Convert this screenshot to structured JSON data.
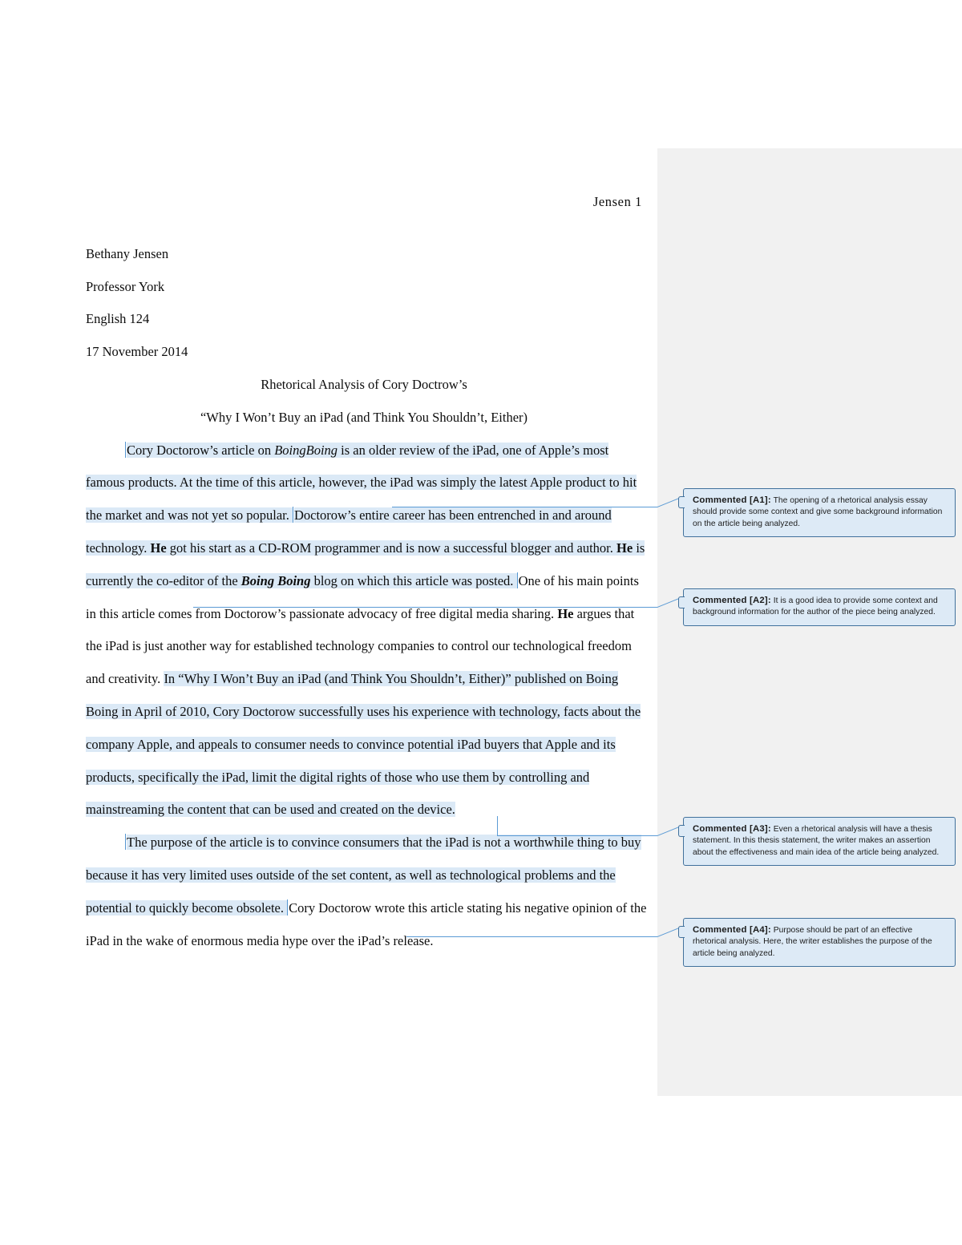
{
  "document": {
    "running_head": "Jensen  1",
    "heading": {
      "author": "Bethany Jensen",
      "instructor": "Professor York",
      "course": "English 124",
      "date": "17 November 2014"
    },
    "title_line_1": "Rhetorical Analysis of Cory Doctrow’s",
    "title_line_2": "“Why I Won’t Buy an iPad (and Think You Shouldn’t, Either)",
    "paragraph_1": {
      "seg_1": "Cory Doctorow’s article on ",
      "seg_2_italic": "BoingBoing",
      "seg_3": " is an older review of the iPad, one of Apple’s most famous products. At the time of this article, however, the iPad was simply the latest Apple product to hit the market and was not yet so popular. ",
      "seg_4": "Doctorow’s entire career has been entrenched in and around technology. ",
      "seg_5_bold": "He",
      "seg_6": " got his start as a CD-ROM programmer and is now a successful blogger and author. ",
      "seg_7_bold": "He",
      "seg_8": " is currently the co-editor of the ",
      "seg_9_italic": "Boing Boing",
      "seg_10": " blog on which this article was posted. ",
      "seg_11": "One of his main points in this article comes from Doctorow’s passionate advocacy of free digital media sharing. ",
      "seg_12_bold": "He",
      "seg_13": " argues that the iPad is just another way for established technology companies to control our technological freedom and creativity. ",
      "seg_14": "In “Why I Won’t Buy an iPad (and Think You Shouldn’t, Either)” published on Boing Boing in April of 2010, Cory Doctorow successfully uses his experience with technology, facts about the company Apple, and appeals to consumer needs to convince potential iPad buyers that Apple and its products, specifically the iPad, limit the digital rights of those who use them by controlling and mainstreaming the content that can be used and created on the device."
    },
    "paragraph_2": {
      "seg_1": "The purpose of the article is to convince consumers that the iPad is not a worthwhile thing to buy because it has very limited uses outside of the set content, as well as technological problems and the potential to quickly become obsolete. ",
      "seg_2": "Cory Doctorow wrote this article stating his negative opinion of the iPad in the wake of enormous media hype over the iPad’s release."
    }
  },
  "comments": [
    {
      "tag": "Commented [A1]:",
      "text": " The opening of a rhetorical analysis essay should provide some context and give some background information on the article being analyzed."
    },
    {
      "tag": "Commented [A2]:",
      "text": " It is a good idea to provide some context and background information for the author of the piece being analyzed."
    },
    {
      "tag": "Commented [A3]:",
      "text": " Even a rhetorical analysis will have a thesis statement. In this thesis statement, the writer makes an assertion about the effectiveness and main idea of the article being analyzed."
    },
    {
      "tag": "Commented [A4]:",
      "text": " Purpose should be part of an effective rhetorical analysis. Here, the writer establishes the purpose of the article being analyzed."
    }
  ],
  "colors": {
    "highlight": "#dbe9f6",
    "comment_fill": "#ddeaf6",
    "comment_border": "#41719c",
    "leader_line": "#5b9bd5",
    "margin_strip": "#f1f1f1"
  }
}
